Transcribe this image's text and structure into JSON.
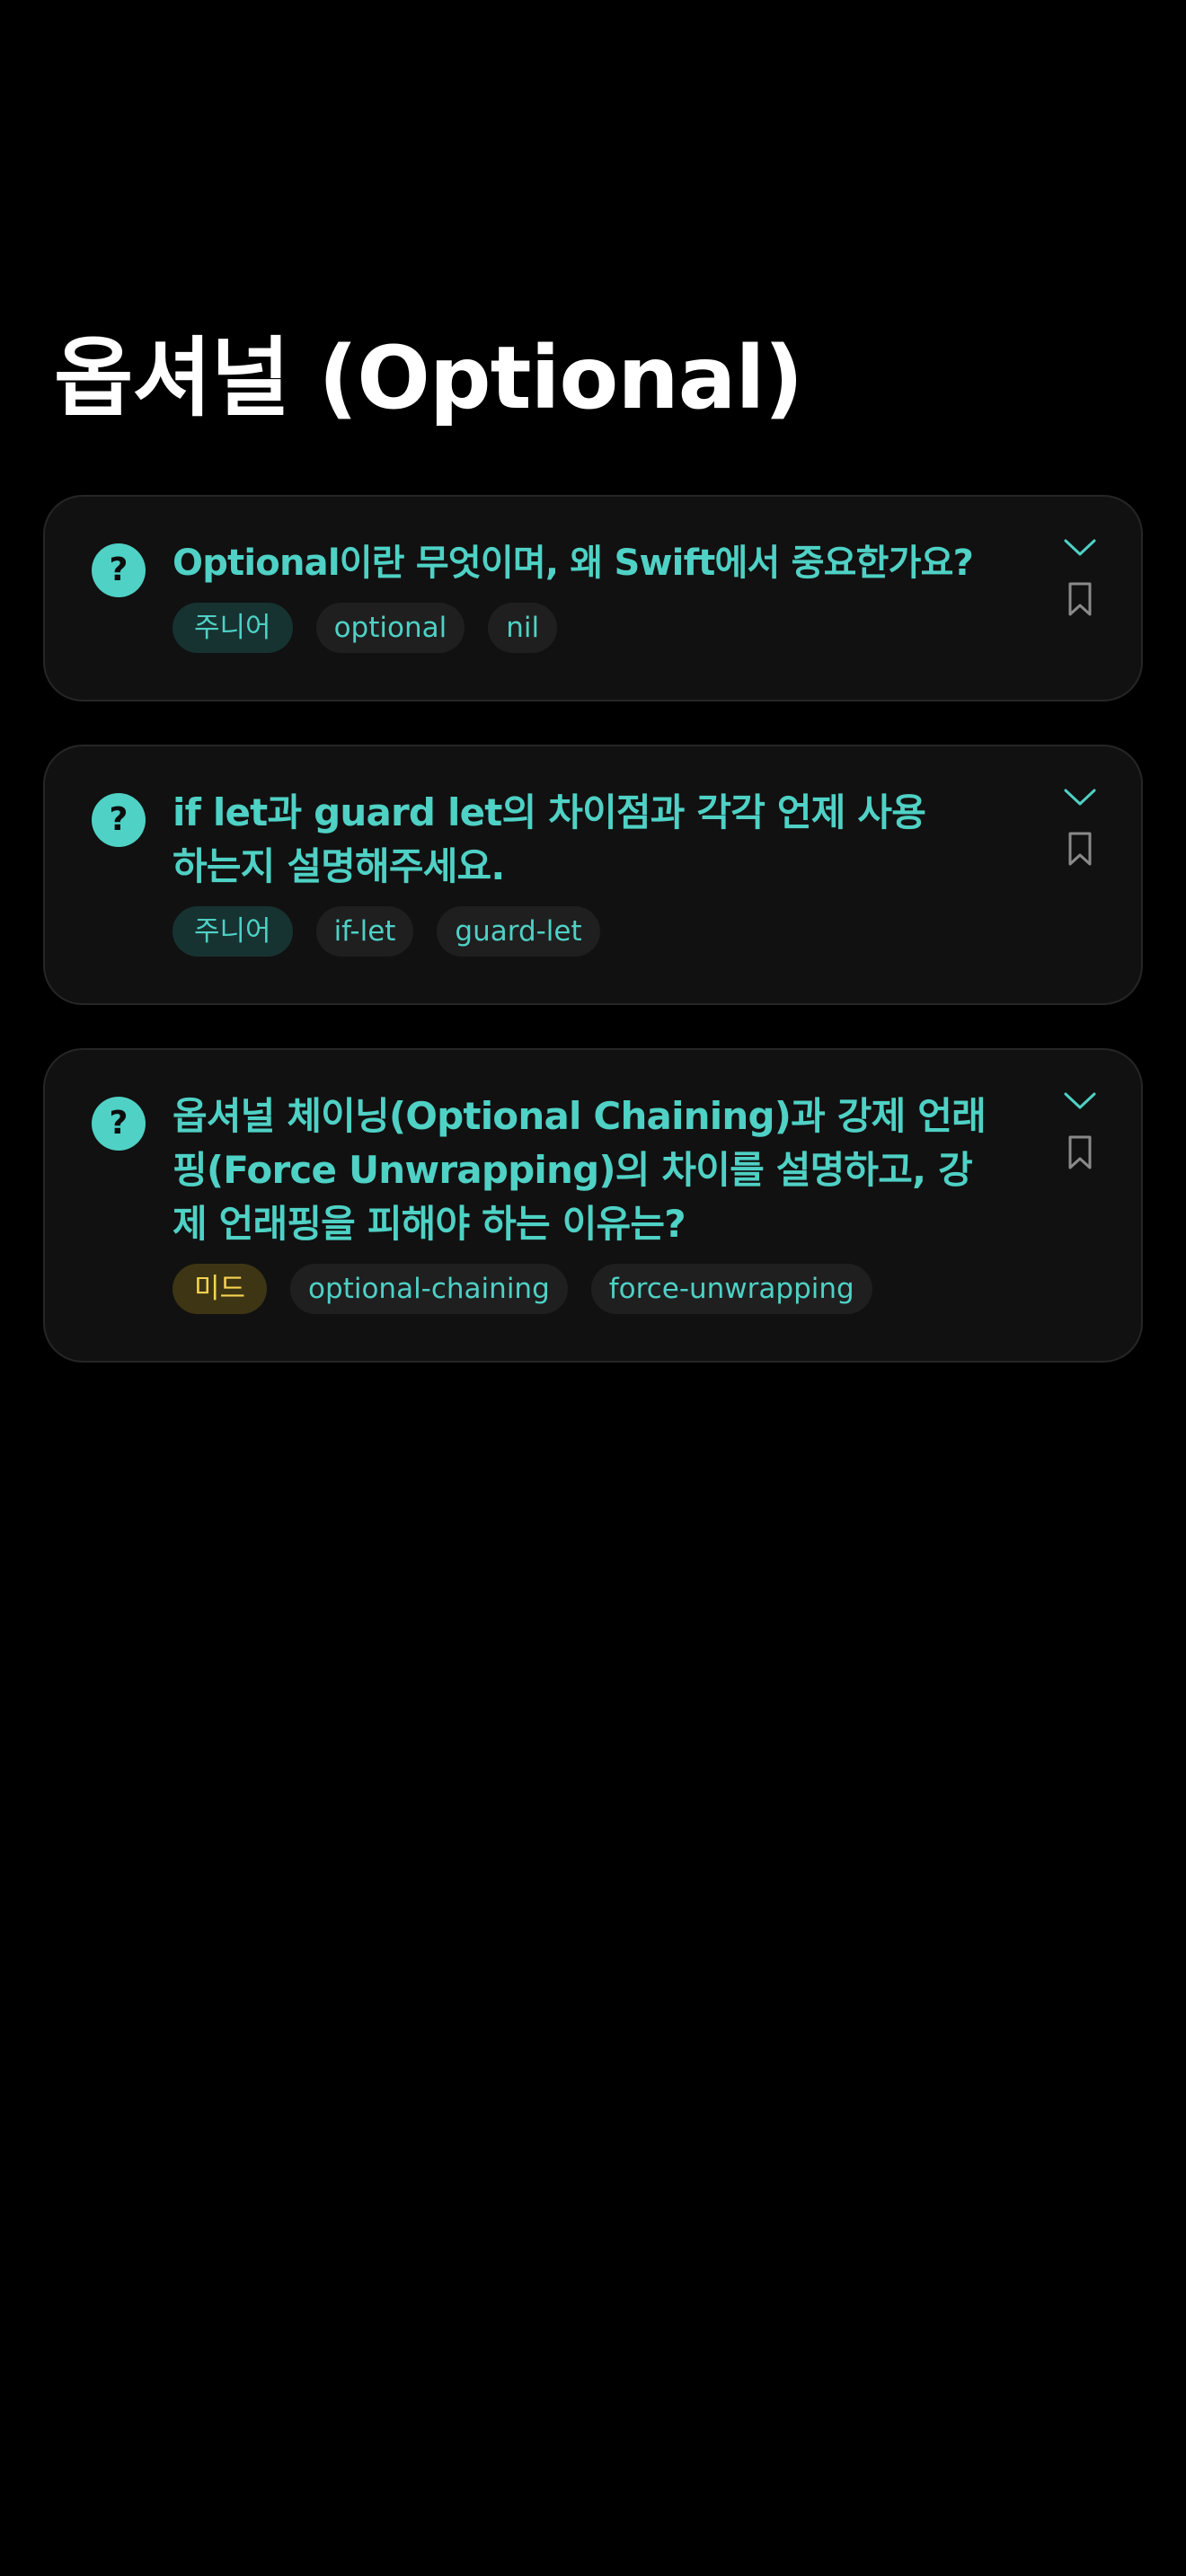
{
  "page": {
    "title": "옵셔널 (Optional)"
  },
  "colors": {
    "background": "#000000",
    "card_background": "#111111",
    "card_border": "#262626",
    "accent": "#4fd1c5",
    "tag_background": "#1f1f1f",
    "junior_background": "#163332",
    "mid_background": "#3d3514",
    "mid_text": "#f6d350"
  },
  "icons": {
    "question": "question-mark-circle",
    "expand": "chevron-down",
    "bookmark": "bookmark-outline"
  },
  "cards": [
    {
      "question_badge": "?",
      "question": "Optional이란 무엇이며, 왜 Swift에서 중요한가요?",
      "level": "주니어",
      "tags": [
        "optional",
        "nil"
      ]
    },
    {
      "question_badge": "?",
      "question": "if let과 guard let의 차이점과 각각 언제 사용하는지 설명해주세요.",
      "level": "주니어",
      "tags": [
        "if-let",
        "guard-let"
      ]
    },
    {
      "question_badge": "?",
      "question": "옵셔널 체이닝(Optional Chaining)과 강제 언래핑(Force Unwrapping)의 차이를 설명하고, 강제 언래핑을 피해야 하는 이유는?",
      "level": "미드",
      "tags": [
        "optional-chaining",
        "force-unwrapping"
      ]
    }
  ]
}
